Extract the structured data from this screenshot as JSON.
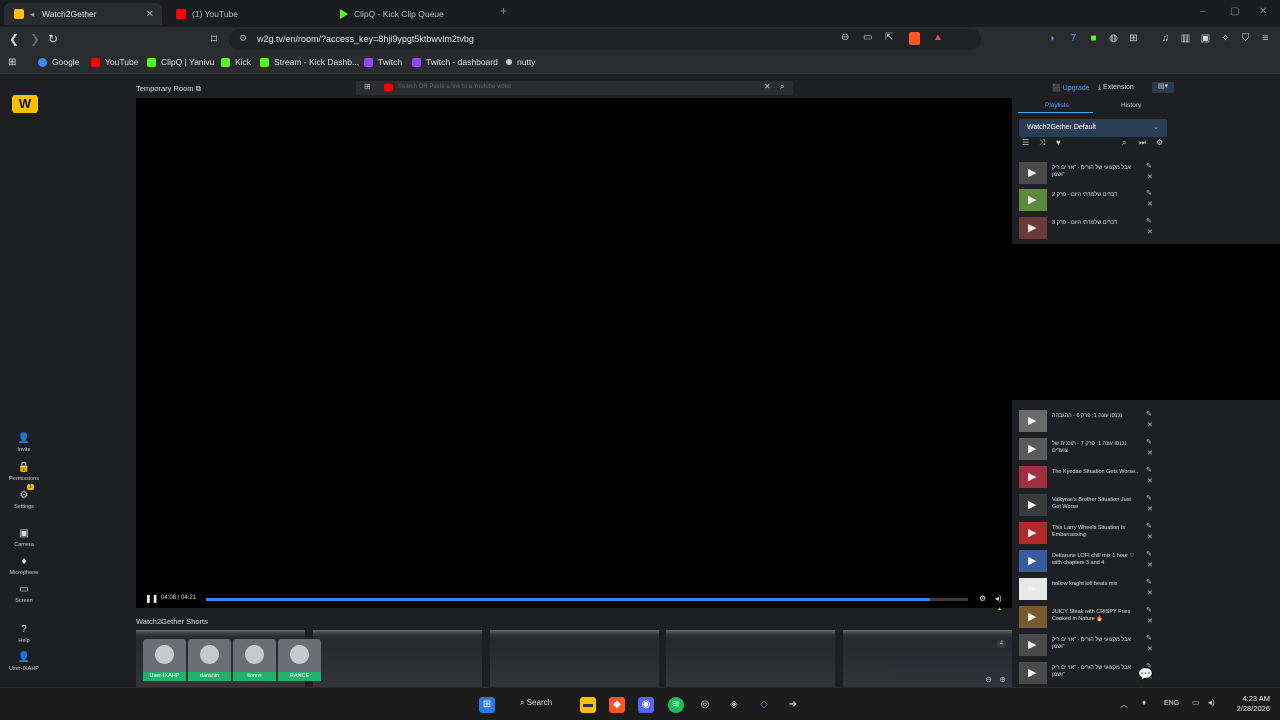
{
  "browser": {
    "tabs": [
      {
        "title": "Watch2Gether",
        "favicon_color": "#f6c000",
        "active": true
      },
      {
        "title": "(1) YouTube",
        "favicon_color": "#ff0000",
        "active": false
      },
      {
        "title": "ClipQ - Kick Clip Queue",
        "favicon_color": "#53fc18",
        "active": false
      }
    ],
    "url": "w2g.tv/en/room/?access_key=8hji9ypgt5ktbwvlm2tvbg",
    "bookmarks": [
      {
        "label": "Google",
        "color": "#4285f4"
      },
      {
        "label": "YouTube",
        "color": "#ff0000"
      },
      {
        "label": "ClipQ | Yanivu",
        "color": "#53fc18"
      },
      {
        "label": "Kick",
        "color": "#53fc18"
      },
      {
        "label": "Stream - Kick Dashb...",
        "color": "#53fc18"
      },
      {
        "label": "Twitch",
        "color": "#9146ff"
      },
      {
        "label": "Twitch - dashboard",
        "color": "#9146ff"
      },
      {
        "label": "nutty",
        "color": "#cccccc"
      }
    ]
  },
  "room": {
    "title": "Temporary Room",
    "search_placeholder": "Search OR Paste a link to a Youtube video",
    "upgrade": "Upgrade",
    "extension": "Extension"
  },
  "sidebar": {
    "items": [
      {
        "label": "Invite",
        "icon": "user-plus-icon"
      },
      {
        "label": "Permissions",
        "icon": "lock-icon"
      },
      {
        "label": "Settings",
        "icon": "gear-icon"
      },
      {
        "label": "Camera",
        "icon": "camera-icon"
      },
      {
        "label": "Microphone",
        "icon": "microphone-icon"
      },
      {
        "label": "Screen",
        "icon": "screen-icon"
      },
      {
        "label": "Help",
        "icon": "help-icon"
      },
      {
        "label": "User-IXAHP",
        "icon": "user-icon"
      }
    ],
    "settings_badge": "1"
  },
  "player": {
    "time": "04:08 / 04:21",
    "progress": 0.95
  },
  "shorts": {
    "title": "Watch2Gether Shorts",
    "count_badge": "4"
  },
  "users": [
    "User-IXAHP",
    "danshin",
    "lionns",
    "RANCE"
  ],
  "playlist": {
    "tab_playlists": "Playlists",
    "tab_history": "History",
    "name": "Watch2Gether Default",
    "items": [
      {
        "title": "אבל מקצועי של הורים - \"אוי ים ריק ושמן\"",
        "thumb": "#4a4a4a"
      },
      {
        "title": "דברים שלמדתי היום - פרק 2",
        "thumb": "#5a8a3a"
      },
      {
        "title": "דברים שלמדתי היום - פרק 3",
        "thumb": "#6a3a3a"
      },
      {
        "title": "נכנסו עונה 1: פרק 6 - ההגבהה",
        "thumb": "#6a6a6a"
      },
      {
        "title": "נכנסו עונה 1: פרק 7 - תוכנית של צועדים",
        "thumb": "#5a5a5a"
      },
      {
        "title": "The Kyedae Situation Gets Worse..",
        "thumb": "#a03040"
      },
      {
        "title": "Valkyrae's Brother Situation Just Got Worse",
        "thumb": "#3a3a3a"
      },
      {
        "title": "This Larry Wheels Situation Is Embarrassing",
        "thumb": "#b02a2a"
      },
      {
        "title": "Deltarune LOFI chill mix 1 hour ♡ with chapters 3 and 4",
        "thumb": "#3a5aa0"
      },
      {
        "title": "hollow knight lofi beats mix",
        "thumb": "#e8e8e8"
      },
      {
        "title": "JUICY Steak with CRISPY Fries Cooked in Nature 🔥",
        "thumb": "#7a5a2a"
      },
      {
        "title": "אבל מקצועי של הורים - \"אוי ים ריק ושמן\"",
        "thumb": "#4a4a4a"
      },
      {
        "title": "אבל מקצועי של הורים - \"אוי ים ריק ושמן\"",
        "thumb": "#4a4a4a"
      }
    ]
  },
  "taskbar": {
    "search_label": "Search",
    "lang": "ENG",
    "time": "4:23 AM",
    "date": "2/28/2026"
  }
}
